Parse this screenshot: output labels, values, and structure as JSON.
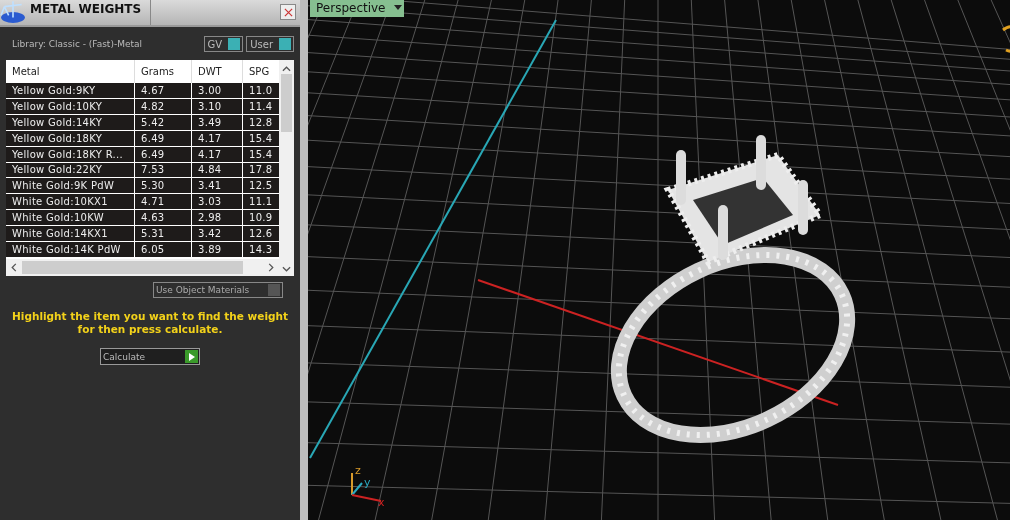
{
  "panel": {
    "title": "METAL WEIGHTS",
    "library": "Library: Classic - (Fast)-Metal",
    "toggles": [
      {
        "label": "GV",
        "on": true
      },
      {
        "label": "User",
        "on": true
      }
    ],
    "table": {
      "columns": [
        "Metal",
        "Grams",
        "DWT",
        "SPG"
      ],
      "rows": [
        [
          "Yellow Gold:9KY",
          "4.67",
          "3.00",
          "11.0"
        ],
        [
          "Yellow Gold:10KY",
          "4.82",
          "3.10",
          "11.4"
        ],
        [
          "Yellow Gold:14KY",
          "5.42",
          "3.49",
          "12.8"
        ],
        [
          "Yellow Gold:18KY",
          "6.49",
          "4.17",
          "15.4"
        ],
        [
          "Yellow Gold:18KY R...",
          "6.49",
          "4.17",
          "15.4"
        ],
        [
          "Yellow Gold:22KY",
          "7.53",
          "4.84",
          "17.8"
        ],
        [
          "White Gold:9K PdW",
          "5.30",
          "3.41",
          "12.5"
        ],
        [
          "White Gold:10KX1",
          "4.71",
          "3.03",
          "11.1"
        ],
        [
          "White Gold:10KW",
          "4.63",
          "2.98",
          "10.9"
        ],
        [
          "White Gold:14KX1",
          "5.31",
          "3.42",
          "12.6"
        ],
        [
          "White Gold:14K PdW",
          "6.05",
          "3.89",
          "14.3"
        ]
      ]
    },
    "use_object_materials": {
      "label": "Use Object Materials",
      "checked": false
    },
    "hint": "Highlight the item you want to find the weight for then press calculate.",
    "calculate": "Calculate"
  },
  "viewport": {
    "view": "Perspective",
    "axes": [
      "z",
      "y",
      "x"
    ]
  }
}
